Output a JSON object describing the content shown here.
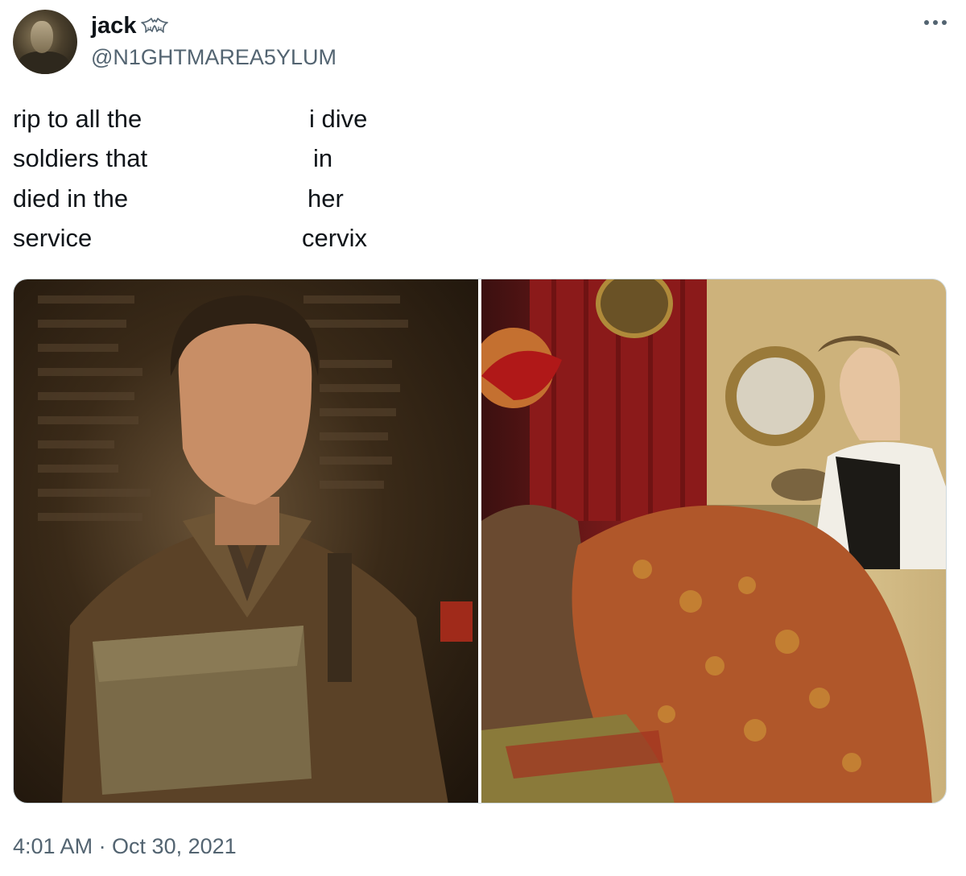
{
  "author": {
    "display_name": "jack",
    "handle": "@N1GHTMAREA5YLUM",
    "badge_icon": "bat-icon"
  },
  "tweet": {
    "left_lines": [
      "rip to all the",
      "soldiers that",
      "died in the",
      "service"
    ],
    "right_lines": [
      "i dive",
      "in",
      "her",
      "cervix"
    ]
  },
  "media": [
    {
      "icon": "photo",
      "subject": "soldier-portrait"
    },
    {
      "icon": "photo",
      "subject": "parlor-scene"
    }
  ],
  "timestamp": "4:01 AM · Oct 30, 2021",
  "colors": {
    "text_primary": "#0f1419",
    "text_secondary": "#536471",
    "border": "#cfd9de"
  }
}
